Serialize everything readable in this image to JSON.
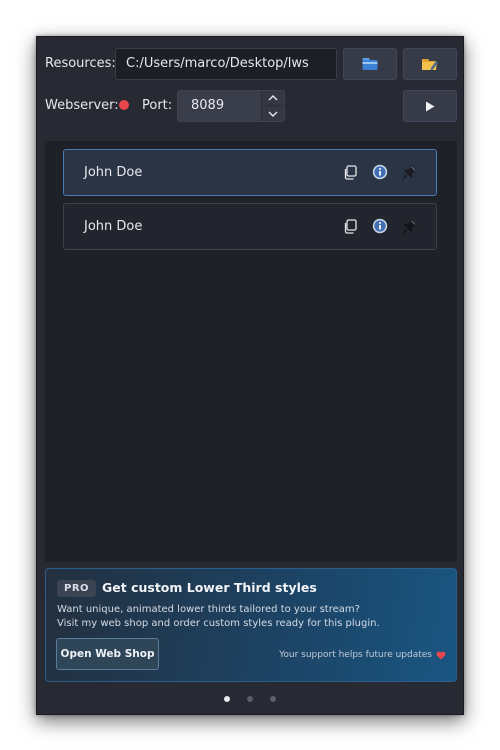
{
  "resources": {
    "label": "Resources:",
    "path": "C:/Users/marco/Desktop/lws",
    "browse_icon": "folder-icon",
    "open_icon": "folder-edit-icon"
  },
  "webserver": {
    "label": "Webserver:",
    "status_color": "#e8464d",
    "port_label": "Port:",
    "port_value": "8089",
    "start_icon": "play-icon"
  },
  "items": [
    {
      "name": "John Doe",
      "selected": true
    },
    {
      "name": "John Doe",
      "selected": false
    }
  ],
  "item_icons": [
    "copy-icon",
    "info-icon",
    "pin-icon"
  ],
  "promo": {
    "badge": "PRO",
    "title": "Get custom Lower Third styles",
    "desc_line1": "Want unique, animated lower thirds tailored to your stream?",
    "desc_line2": "Visit my web shop and order custom styles ready for this plugin.",
    "button": "Open Web Shop",
    "support": "Your support helps future updates"
  },
  "pager": {
    "pages": 3,
    "active": 0
  }
}
